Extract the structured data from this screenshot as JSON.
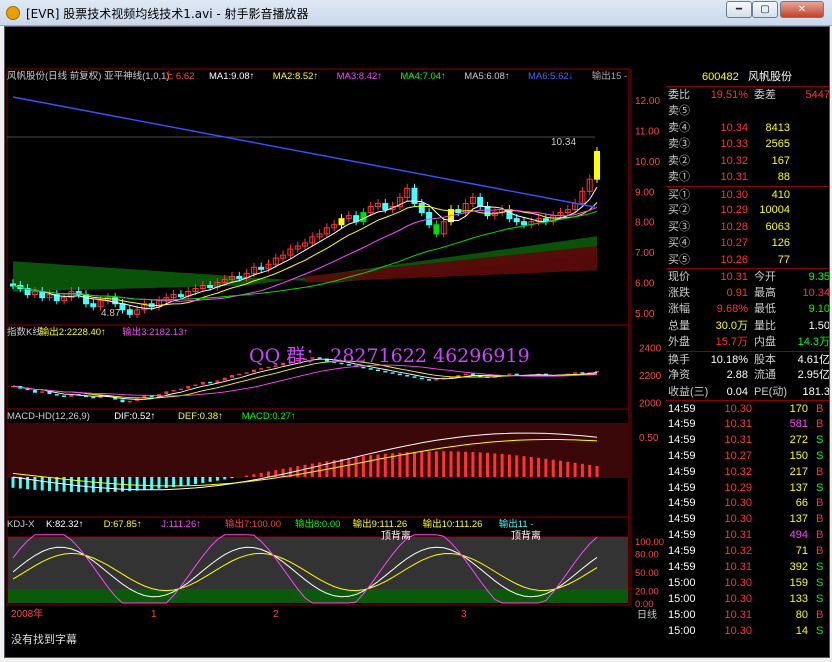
{
  "window": {
    "title": "[EVR] 股票技术视频均线技术1.avi - 射手影音播放器",
    "btn_min": "━",
    "btn_max": "▢",
    "btn_close": "✕"
  },
  "colors": {
    "up": "#ff3333",
    "down": "#44ffff",
    "bg": "#000000",
    "grid": "#8b0000",
    "ma1": "#ffffff",
    "ma2": "#ffff00",
    "ma3": "#ff44ff",
    "ma4": "#00dd00",
    "ma5": "#cccccc",
    "ma6": "#3355ff",
    "yellow_candle": "#ffff00",
    "green_candle": "#00dd00"
  },
  "main": {
    "legend": [
      {
        "text": "风帆股份(日线 前复权) 亚平神线(1,0,1)",
        "color": "#cccccc"
      },
      {
        "text": "上 6.62",
        "color": "#ff4444"
      },
      {
        "text": "MA1:9.08↑",
        "color": "#ffffff"
      },
      {
        "text": "MA2:8.52↑",
        "color": "#ffff00"
      },
      {
        "text": "MA3:8.42↑",
        "color": "#ff44ff"
      },
      {
        "text": "MA4:7.04↑",
        "color": "#00ff00"
      },
      {
        "text": "MA5:6.08↑",
        "color": "#cccccc"
      },
      {
        "text": "MA6:5.62↓",
        "color": "#4466ff"
      },
      {
        "text": "输出15 -",
        "color": "#aaaaaa"
      }
    ],
    "yticks": [
      "12.00",
      "11.00",
      "10.00",
      "9.00",
      "8.00",
      "7.00",
      "6.00",
      "5.00"
    ],
    "high_label": "10.34",
    "low_label": "4.87"
  },
  "index": {
    "legend": [
      {
        "text": "指数K线",
        "color": "#cccccc"
      },
      {
        "text": "输出2:2228.40↑",
        "color": "#ffff00"
      },
      {
        "text": "输出3:2182.13↑",
        "color": "#ff44ff"
      }
    ],
    "yticks": [
      "2400",
      "2200",
      "2000"
    ]
  },
  "macd": {
    "legend": [
      {
        "text": "MACD-HD(12,26,9)",
        "color": "#cccccc"
      },
      {
        "text": "DIF:0.52↑",
        "color": "#ffffff"
      },
      {
        "text": "DEF:0.38↑",
        "color": "#ffff00"
      },
      {
        "text": "MACD:0.27↑",
        "color": "#00ff00"
      }
    ],
    "yticks": [
      "0.50"
    ]
  },
  "kdj": {
    "legend": [
      {
        "text": "KDJ-X",
        "color": "#cccccc"
      },
      {
        "text": "K:82.32↑",
        "color": "#ffffff"
      },
      {
        "text": "D:67.85↑",
        "color": "#ffff00"
      },
      {
        "text": "J:111.26↑",
        "color": "#ff44ff"
      },
      {
        "text": "输出7:100.00",
        "color": "#ff4444"
      },
      {
        "text": "输出8:0.00",
        "color": "#00ff00"
      },
      {
        "text": "输出9:111.26",
        "color": "#ffff00"
      },
      {
        "text": "输出10:111.26",
        "color": "#ffff00"
      },
      {
        "text": "输出11 -",
        "color": "#44ffff"
      }
    ],
    "yticks": [
      "100.00",
      "80.00",
      "50.00",
      "20.00",
      "0.00"
    ],
    "annotations": [
      "顶背离",
      "顶背离"
    ]
  },
  "date_axis": {
    "labels": [
      "2008年",
      "1",
      "2",
      "3"
    ],
    "period": "日线"
  },
  "status": "没有找到字幕",
  "watermark": "QQ  群：  28271622    46296919",
  "quote": {
    "code": "600482",
    "name": "风帆股份",
    "weibi_label": "委比",
    "weibi": "19.51%",
    "weicha_label": "委差",
    "weicha": "5447",
    "asks": [
      {
        "label": "卖⑤",
        "price": "",
        "vol": ""
      },
      {
        "label": "卖④",
        "price": "10.34",
        "vol": "8413"
      },
      {
        "label": "卖③",
        "price": "10.33",
        "vol": "2565"
      },
      {
        "label": "卖②",
        "price": "10.32",
        "vol": "167"
      },
      {
        "label": "卖①",
        "price": "10.31",
        "vol": "88"
      }
    ],
    "bids": [
      {
        "label": "买①",
        "price": "10.30",
        "vol": "410"
      },
      {
        "label": "买②",
        "price": "10.29",
        "vol": "10004"
      },
      {
        "label": "买③",
        "price": "10.28",
        "vol": "6063"
      },
      {
        "label": "买④",
        "price": "10.27",
        "vol": "126"
      },
      {
        "label": "买⑤",
        "price": "10.26",
        "vol": "77"
      }
    ],
    "stats": [
      {
        "l1": "现价",
        "v1": "10.31",
        "c1": "#ff3333",
        "l2": "今开",
        "v2": "9.35",
        "c2": "#00ff00"
      },
      {
        "l1": "涨跌",
        "v1": "0.91",
        "c1": "#ff3333",
        "l2": "最高",
        "v2": "10.34",
        "c2": "#ff3333"
      },
      {
        "l1": "涨幅",
        "v1": "9.68%",
        "c1": "#ff3333",
        "l2": "最低",
        "v2": "9.10",
        "c2": "#00ff00"
      },
      {
        "l1": "总量",
        "v1": "30.0万",
        "c1": "#ffff00",
        "l2": "量比",
        "v2": "1.50",
        "c2": "#ffffff"
      },
      {
        "l1": "外盘",
        "v1": "15.7万",
        "c1": "#ff3333",
        "l2": "内盘",
        "v2": "14.3万",
        "c2": "#00ff00"
      }
    ],
    "stats2": [
      {
        "l1": "换手",
        "v1": "10.18%",
        "l2": "股本",
        "v2": "4.61亿"
      },
      {
        "l1": "净资",
        "v1": "2.88",
        "l2": "流通",
        "v2": "2.95亿"
      },
      {
        "l1": "收益(三)",
        "v1": "0.04",
        "l2": "PE(动)",
        "v2": "181.3"
      }
    ],
    "ticks": [
      {
        "t": "14:59",
        "p": "10.30",
        "v": "170",
        "d": "B"
      },
      {
        "t": "14:59",
        "p": "10.31",
        "v": "581",
        "d": "B"
      },
      {
        "t": "14:59",
        "p": "10.31",
        "v": "272",
        "d": "S"
      },
      {
        "t": "14:59",
        "p": "10.27",
        "v": "150",
        "d": "S"
      },
      {
        "t": "14:59",
        "p": "10.32",
        "v": "217",
        "d": "B"
      },
      {
        "t": "14:59",
        "p": "10.29",
        "v": "137",
        "d": "S"
      },
      {
        "t": "14:59",
        "p": "10.30",
        "v": "66",
        "d": "B"
      },
      {
        "t": "14:59",
        "p": "10.30",
        "v": "137",
        "d": "B"
      },
      {
        "t": "14:59",
        "p": "10.31",
        "v": "494",
        "d": "B"
      },
      {
        "t": "14:59",
        "p": "10.32",
        "v": "71",
        "d": "B"
      },
      {
        "t": "14:59",
        "p": "10.31",
        "v": "392",
        "d": "S"
      },
      {
        "t": "15:00",
        "p": "10.30",
        "v": "159",
        "d": "S"
      },
      {
        "t": "15:00",
        "p": "10.30",
        "v": "133",
        "d": "S"
      },
      {
        "t": "15:00",
        "p": "10.31",
        "v": "80",
        "d": "B"
      },
      {
        "t": "15:00",
        "p": "10.30",
        "v": "14",
        "d": "S"
      }
    ]
  },
  "series": {
    "close": [
      5.9,
      5.8,
      5.6,
      5.7,
      5.5,
      5.6,
      5.4,
      5.5,
      5.7,
      5.6,
      5.3,
      5.2,
      5.4,
      5.5,
      5.3,
      5.1,
      4.95,
      5.1,
      5.3,
      5.2,
      5.4,
      5.5,
      5.6,
      5.55,
      5.7,
      5.8,
      5.9,
      5.85,
      6.0,
      6.1,
      6.2,
      6.15,
      6.3,
      6.5,
      6.45,
      6.6,
      6.8,
      6.9,
      7.1,
      7.2,
      7.3,
      7.5,
      7.6,
      7.8,
      7.9,
      8.1,
      8.2,
      8.0,
      8.3,
      8.5,
      8.6,
      8.4,
      8.5,
      8.8,
      9.1,
      8.6,
      8.3,
      7.9,
      7.6,
      8.0,
      8.4,
      8.3,
      8.6,
      8.8,
      8.5,
      8.2,
      8.3,
      8.4,
      8.1,
      8.0,
      7.9,
      8.0,
      8.1,
      8.0,
      8.2,
      8.3,
      8.4,
      8.6,
      9.0,
      9.4,
      10.31
    ],
    "index": [
      2120,
      2100,
      2090,
      2070,
      2080,
      2060,
      2050,
      2040,
      2060,
      2050,
      2040,
      2030,
      2050,
      2040,
      2020,
      2000,
      2010,
      2030,
      2050,
      2040,
      2060,
      2080,
      2090,
      2100,
      2120,
      2130,
      2150,
      2140,
      2160,
      2180,
      2200,
      2210,
      2220,
      2240,
      2250,
      2260,
      2270,
      2290,
      2300,
      2310,
      2320,
      2330,
      2320,
      2300,
      2290,
      2280,
      2270,
      2260,
      2250,
      2240,
      2230,
      2220,
      2210,
      2200,
      2190,
      2180,
      2170,
      2160,
      2170,
      2180,
      2190,
      2200,
      2210,
      2200,
      2190,
      2180,
      2190,
      2200,
      2210,
      2200,
      2190,
      2200,
      2210,
      2200,
      2190,
      2200,
      2210,
      2220,
      2210,
      2220,
      2230
    ]
  }
}
